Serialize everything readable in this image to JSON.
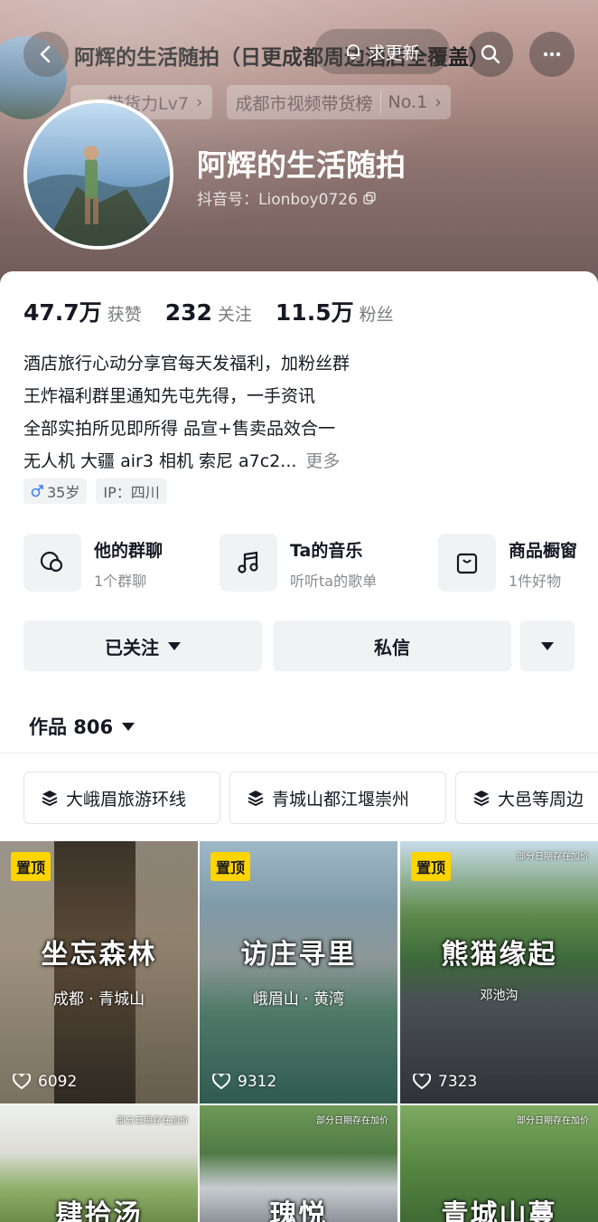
{
  "header": {
    "title": "阿辉的生活随拍（日更成都周边酒店全覆盖）",
    "search_pill_label": "求更新",
    "badges": [
      {
        "label": "带货力Lv7"
      },
      {
        "label": "成都市视频带货榜",
        "rank": "No.1"
      }
    ],
    "nickname": "阿辉的生活随拍",
    "douyin_id": "抖音号：Lionboy0726"
  },
  "stats": [
    {
      "num": "47.7万",
      "label": "获赞"
    },
    {
      "num": "232",
      "label": "关注"
    },
    {
      "num": "11.5万",
      "label": "粉丝"
    }
  ],
  "bio": {
    "lines": [
      "酒店旅行心动分享官每天发福利，加粉丝群",
      "王炸福利群里通知先屯先得，一手资讯",
      "全部实拍所见即所得 品宣+售卖品效合一",
      "无人机 大疆 air3 相机 索尼 a7c2..."
    ],
    "more": "更多"
  },
  "tags": [
    {
      "label": "35岁",
      "icon": "male-icon"
    },
    {
      "label": "IP：四川"
    }
  ],
  "features": [
    {
      "title": "他的群聊",
      "sub": "1个群聊",
      "icon": "chat-bubbles-icon"
    },
    {
      "title": "Ta的音乐",
      "sub": "听听ta的歌单",
      "icon": "music-note-icon"
    },
    {
      "title": "商品橱窗",
      "sub": "1件好物",
      "icon": "shopping-bag-icon"
    }
  ],
  "actions": {
    "follow_label": "已关注",
    "message_label": "私信"
  },
  "works": {
    "label": "作品 806"
  },
  "collections": [
    {
      "label": "大峨眉旅游环线"
    },
    {
      "label": "青城山都江堰崇州"
    },
    {
      "label": "大邑等周边"
    }
  ],
  "videos": [
    {
      "pinned": "置顶",
      "title": "坐忘森林",
      "subtitle": "成都 · 青城山",
      "likes": "6092",
      "note": ""
    },
    {
      "pinned": "置顶",
      "title": "访庄寻里",
      "subtitle": "峨眉山 · 黄湾",
      "likes": "9312",
      "note": ""
    },
    {
      "pinned": "置顶",
      "title": "熊猫缘起",
      "subtitle": "邓池沟",
      "likes": "7323",
      "note": "部分日期存在加价"
    },
    {
      "pinned": "",
      "title": "肆拾汤",
      "subtitle": "",
      "likes": "",
      "note": "部分日期存在加价"
    },
    {
      "pinned": "",
      "title": "瑰悦",
      "subtitle": "",
      "likes": "",
      "note": "部分日期存在加价"
    },
    {
      "pinned": "",
      "title": "青城山蔓",
      "subtitle": "",
      "likes": "",
      "note": "部分日期存在加价"
    }
  ],
  "colors": {
    "accent_pin": "#ffd400",
    "text_primary": "#161823",
    "text_secondary": "#8a8b90",
    "button_bg": "#f1f2f4"
  }
}
